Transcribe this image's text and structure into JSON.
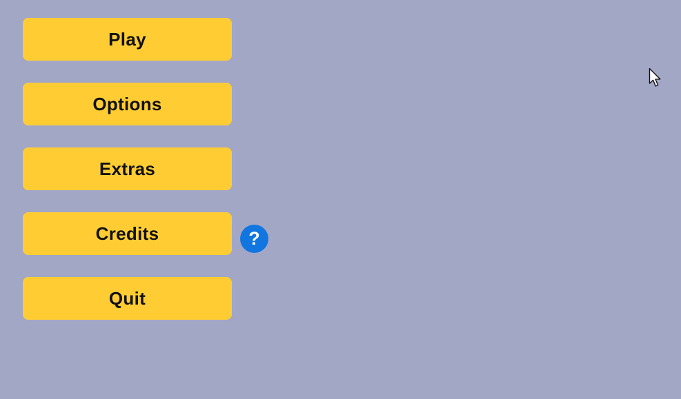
{
  "menu": {
    "buttons": [
      {
        "label": "Play"
      },
      {
        "label": "Options"
      },
      {
        "label": "Extras"
      },
      {
        "label": "Credits"
      },
      {
        "label": "Quit"
      }
    ]
  },
  "help": {
    "glyph": "?",
    "icon": "question-mark-circle-icon"
  },
  "cursor": {
    "icon": "mouse-pointer-icon"
  },
  "colors": {
    "background": "#a3a7c6",
    "button": "#ffcd33",
    "button_text": "#111111",
    "help_icon": "#1176df"
  }
}
